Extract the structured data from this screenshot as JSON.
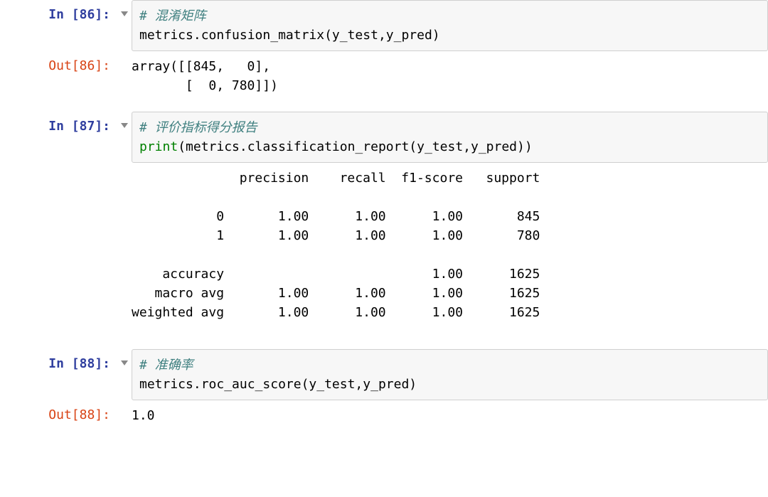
{
  "cells": {
    "c86_in": {
      "prompt": "In [86]:",
      "comment": "# 混淆矩阵",
      "code": "metrics.confusion_matrix(y_test,y_pred)"
    },
    "c86_out": {
      "prompt": "Out[86]:",
      "text": "array([[845,   0],\n       [  0, 780]])"
    },
    "c87_in": {
      "prompt": "In [87]:",
      "comment": "# 评价指标得分报告",
      "call": "print",
      "code_rest": "(metrics.classification_report(y_test,y_pred))"
    },
    "c87_out": {
      "text": "              precision    recall  f1-score   support\n\n           0       1.00      1.00      1.00       845\n           1       1.00      1.00      1.00       780\n\n    accuracy                           1.00      1625\n   macro avg       1.00      1.00      1.00      1625\nweighted avg       1.00      1.00      1.00      1625\n"
    },
    "c88_in": {
      "prompt": "In [88]:",
      "comment": "# 准确率",
      "code": "metrics.roc_auc_score(y_test,y_pred)"
    },
    "c88_out": {
      "prompt": "Out[88]:",
      "text": "1.0"
    }
  },
  "chart_data": {
    "type": "table",
    "title": "classification_report",
    "confusion_matrix": [
      [
        845,
        0
      ],
      [
        0,
        780
      ]
    ],
    "rows": [
      {
        "label": "0",
        "precision": 1.0,
        "recall": 1.0,
        "f1-score": 1.0,
        "support": 845
      },
      {
        "label": "1",
        "precision": 1.0,
        "recall": 1.0,
        "f1-score": 1.0,
        "support": 780
      },
      {
        "label": "accuracy",
        "precision": null,
        "recall": null,
        "f1-score": 1.0,
        "support": 1625
      },
      {
        "label": "macro avg",
        "precision": 1.0,
        "recall": 1.0,
        "f1-score": 1.0,
        "support": 1625
      },
      {
        "label": "weighted avg",
        "precision": 1.0,
        "recall": 1.0,
        "f1-score": 1.0,
        "support": 1625
      }
    ],
    "roc_auc_score": 1.0
  }
}
